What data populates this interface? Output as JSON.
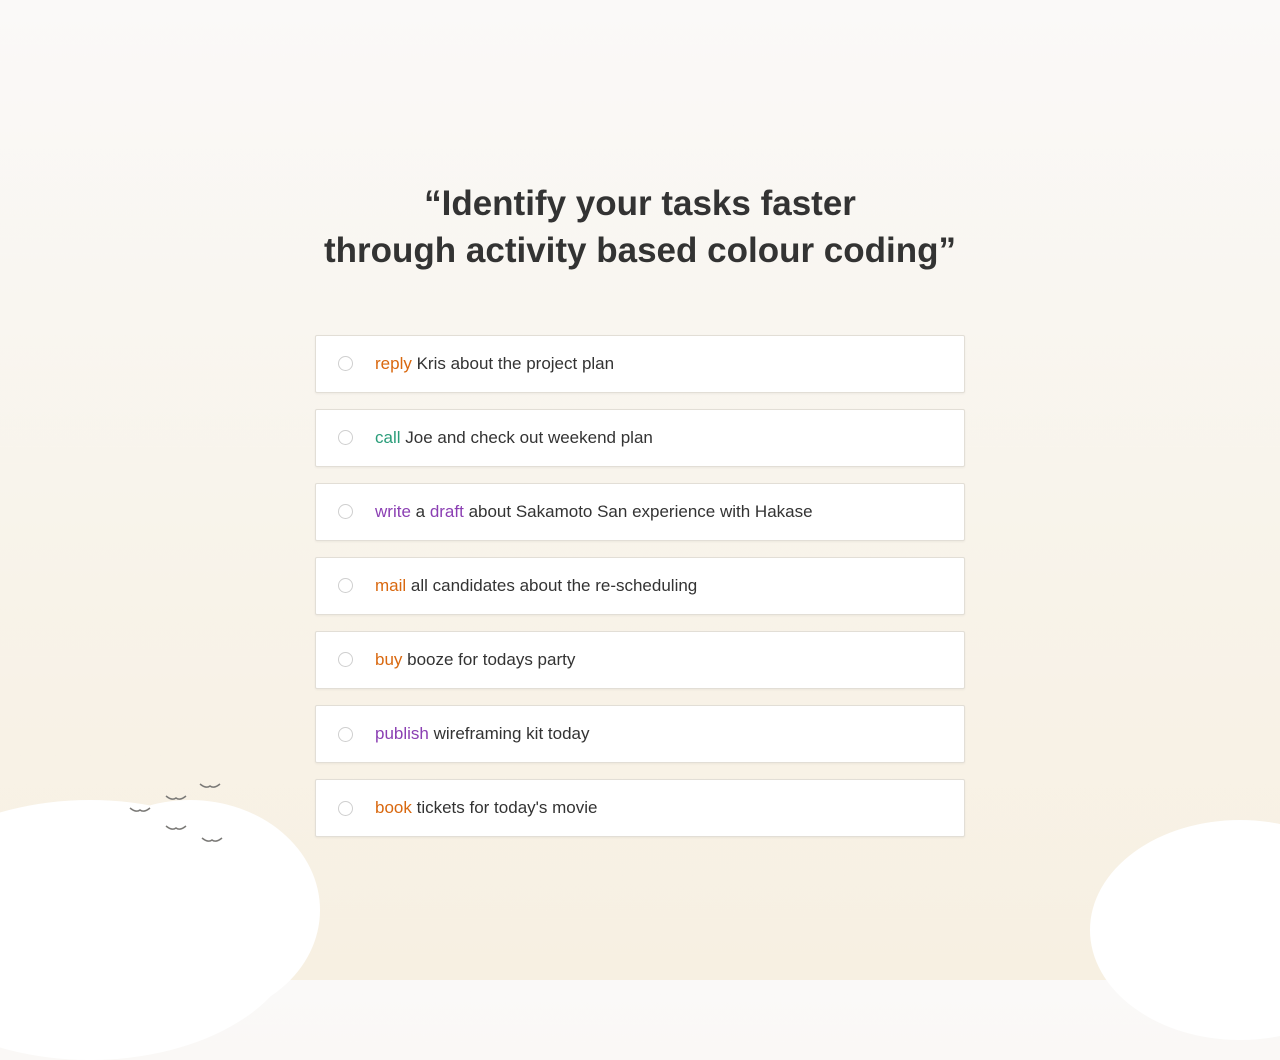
{
  "heading_line1": "“Identify your tasks faster",
  "heading_line2": "through activity based colour coding”",
  "colors": {
    "orange": "#d9680f",
    "teal": "#2a9d7a",
    "purple": "#8b3fb3"
  },
  "tasks": [
    {
      "parts": [
        {
          "text": "reply",
          "color": "orange"
        },
        {
          "text": " Kris about the project plan"
        }
      ]
    },
    {
      "parts": [
        {
          "text": "call",
          "color": "teal"
        },
        {
          "text": " Joe and check out weekend plan"
        }
      ]
    },
    {
      "parts": [
        {
          "text": "write",
          "color": "purple"
        },
        {
          "text": " a "
        },
        {
          "text": "draft",
          "color": "purple"
        },
        {
          "text": " about Sakamoto San experience with Hakase"
        }
      ]
    },
    {
      "parts": [
        {
          "text": "mail",
          "color": "orange"
        },
        {
          "text": " all candidates about the re-scheduling"
        }
      ]
    },
    {
      "parts": [
        {
          "text": "buy",
          "color": "orange"
        },
        {
          "text": " booze for todays party"
        }
      ]
    },
    {
      "parts": [
        {
          "text": "publish",
          "color": "purple"
        },
        {
          "text": " wireframing kit today"
        }
      ]
    },
    {
      "parts": [
        {
          "text": "book",
          "color": "orange"
        },
        {
          "text": " tickets for today's movie"
        }
      ]
    }
  ]
}
